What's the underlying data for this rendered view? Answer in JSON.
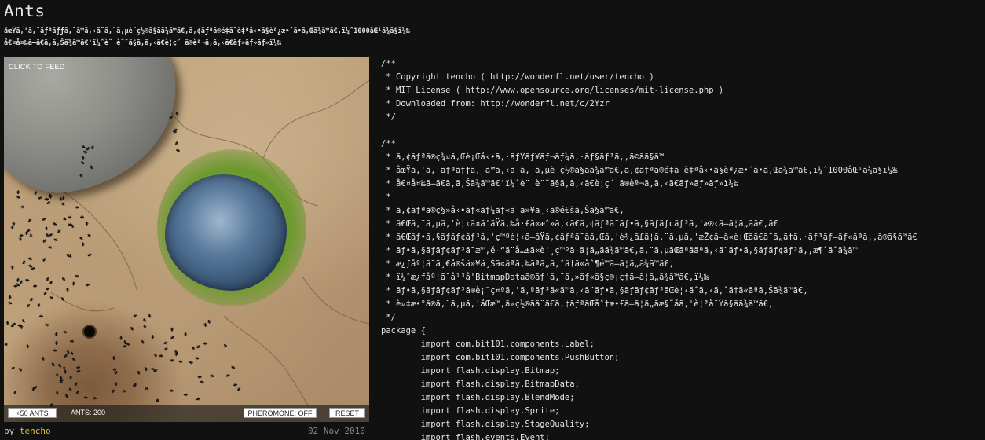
{
  "page": {
    "title": "Ants",
    "description_lines": [
      "åœŸã‚'ã‚¯ãƒªãƒƒã‚¯ã™ã‚‹ã¨ã‚¨ã‚µè¨­ç½®ã§ãã¾ã™ã€‚ã‚¢ãƒªã®é‡ã¯è‡ªå‹•ã§èª¿æ•´ã•ã‚Œã¾ã™ã€‚ï¼ˆ1000åŒ¹ã¾ã§ï¼‰",
      "å€¤å¤‰ã—ã€ã‚ã‚Šã¾ã™ã€'ï¼ˆè¨ è¨˜ã§ã‚ã‚‹ã€è¦ç´ ã®èª¬ã‚ã‚‹ã€ãƒ»ãƒ»ãƒ»ï¼‰"
    ]
  },
  "game": {
    "click_to_feed": "CLICK TO FEED",
    "add_ants_label": "+50 ANTS",
    "ants_count_text": "ANTS: 200",
    "pheromone_label": "PHEROMONE: OFF",
    "reset_label": "RESET"
  },
  "footer": {
    "by_label": "by",
    "author": "tencho",
    "date": "02 Nov 2010"
  },
  "code_lines": [
    "/**",
    " * Copyright tencho ( http://wonderfl.net/user/tencho )",
    " * MIT License ( http://www.opensource.org/licenses/mit-license.php )",
    " * Downloaded from: http://wonderfl.net/c/2Yzr",
    " */",
    "",
    "/**",
    " * ã‚¢ãƒªã®ç¾¤ã‚Œè¡Œå‹•ã‚·ãƒŸãƒ¥ãƒ¬ãƒ¼ã‚·ãƒ§ãƒ³ã‚‚ã©ãã§ã™",
    " * åœŸã‚'ã‚¯ãƒªãƒƒã‚¯ã™ã‚‹ã¨ã‚¨ã‚µè¨­ç½®ã§ãã¾ã™ã€‚ã‚¢ãƒªã®é‡ã¯è‡ªå‹•ã§èª¿æ•´ã•ã‚Œã¾ã™ã€‚ï¼ˆ1000åŒ¹ã¾ã§ï¼‰",
    " * å€¤å¤‰ã—ã€ã‚ã‚Šã¾ã™ã€'ï¼ˆè¨ è¨˜ã§ã‚ã‚‹ã€è¦ç´ ã®èª¬ã‚ã‚‹ã€ãƒ»ãƒ»ãƒ»ï¼‰",
    " *",
    " * ã‚¢ãƒªã®ç§»å‹•ãƒ«ãƒ¼ãƒ«ã¯ä»¥ä¸‹ã®é€šã‚Šã§ã™ã€‚",
    " * ã€Œã‚¨ã‚µã‚'è¦‹ã¤ã'ãŸã‚‰å·£ã«æˆ»ã‚‹ã€ã‚¢ãƒªã¯ãƒ•ã‚§ãƒ­ãƒ¢ãƒ³ã‚'æ®‹ã—ã¦ã„ãã€‚ã€",
    " * ã€Œãƒ•ã‚§ãƒ­ãƒ¢ãƒ³ã‚'ç™ºè¦‹ã—ãŸã‚¢ãƒªã¯ãã‚Œã‚'è¾¿ã£ã¦ã‚¨ã‚µã‚'æŽ¢ã—ã«è¡Œãã€ã¨ã„ã†ã‚·ãƒ³ãƒ—ãƒ«ãªã‚‚ã®ã§ã™ã€",
    " * ãƒ•ã‚§ãƒ­ãƒ¢ãƒ³ã¯æ™‚é–“ã¨å…±ã«è'¸ç™ºã—ã¦ã„ãã¾ã™ã€‚ã‚¨ã‚µãŒãªããªã‚‹ã¨ãƒ•ã‚§ãƒ­ãƒ¢ãƒ³ã‚‚æ¶ˆãˆã¾ã™",
    " * æ¿ƒåº¦ã¯ä¸€å®šä»¥ä¸Šã«ãªã‚‰ãªã„ã‚ˆã†ã«åˆ¶é™ã—ã¦ã„ã¾ã™ã€‚",
    " * ï¼ˆæ¿ƒåº¦ã¯å¹³å'BitmapDataã®ãƒ'ã‚¯ã‚»ãƒ«ã§ç®¡ç†ã—ã¦ã„ã¾ã™ã€‚ï¼‰",
    " * ãƒ•ã‚§ãƒ­ãƒ¢ãƒ³ã®è¡¨ç¤ºã‚'ã‚ªãƒ³ã«ã™ã‚‹ã¨ãƒ•ã‚§ãƒ­ãƒ¢ãƒ³ãŒè¦‹ãˆã‚‹ã‚ˆã†ã«ãªã‚Šã¾ã™ã€‚",
    " * è¤‡æ•°ã®ã‚¨ã‚µã‚'åŒæ™‚ã«ç½®ãã¨ã€ã‚¢ãƒªãŒåˆ†æ•£ã—ã¦ã„ãæ§˜å­ã‚'è¦³å¯Ÿã§ãã¾ã™ã€‚",
    " */",
    "package {",
    "        import com.bit101.components.Label;",
    "        import com.bit101.components.PushButton;",
    "        import flash.display.Bitmap;",
    "        import flash.display.BitmapData;",
    "        import flash.display.BlendMode;",
    "        import flash.display.Sprite;",
    "        import flash.display.StageQuality;",
    "        import flash.events.Event;"
  ]
}
